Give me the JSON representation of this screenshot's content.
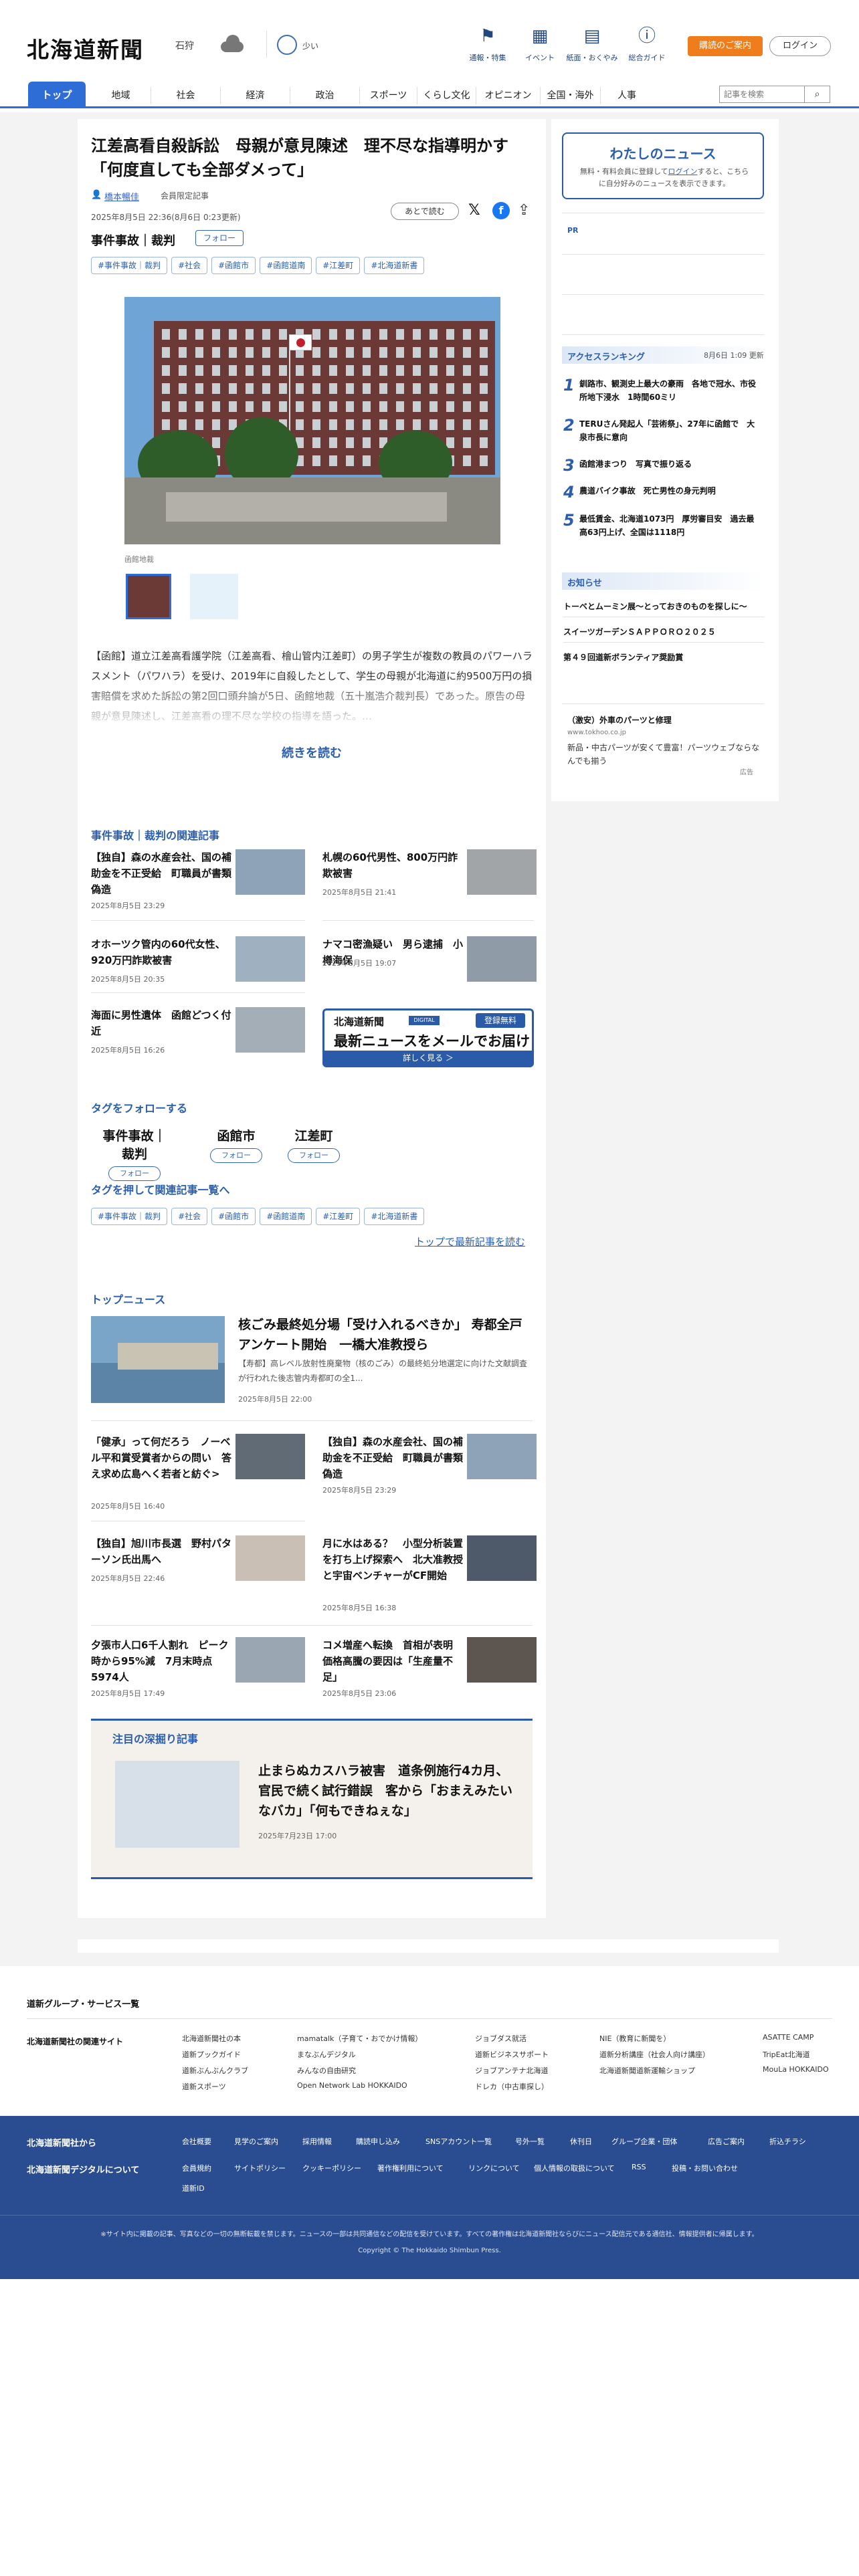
{
  "header": {
    "logo": "北海道新聞",
    "city": "石狩",
    "pollen_label": "少い",
    "top_nav": [
      {
        "label": "通報・特集",
        "icon": "flag-icon"
      },
      {
        "label": "イベント",
        "icon": "calendar-icon"
      },
      {
        "label": "紙面・おくやみ",
        "icon": "newspaper-icon"
      },
      {
        "label": "総合ガイド",
        "icon": "help-icon"
      }
    ],
    "subscribe_label": "購読のご案内",
    "login_label": "ログイン",
    "search_placeholder": "記事を検索"
  },
  "nav": [
    "トップ",
    "地域",
    "社会",
    "経済",
    "政治",
    "スポーツ",
    "くらし文化",
    "オピニオン",
    "全国・海外",
    "人事"
  ],
  "article": {
    "title": "江差高看自殺訴訟　母親が意見陳述　理不尽な指導明かす「何度直しても全部ダメって」",
    "author": "橋本暢佳",
    "member_label": "会員限定記事",
    "date": "2025年8月5日 22:36(8月6日 0:23更新)",
    "later_label": "あとで読む",
    "category": "事件事故｜裁判",
    "follow_label": "フォロー",
    "tags": [
      "#事件事故｜裁判",
      "#社会",
      "#函館市",
      "#函館道南",
      "#江差町",
      "#北海道新書"
    ],
    "photo_caption": "函館地裁",
    "lead": "【函館】道立江差高看護学院（江差高看、檜山管内江差町）の男子学生が複数の教員のパワーハラスメント（パワハラ）を受け、2019年に自殺したとして、学生の母親が北海道に約9500万円の損害賠償を求めた訴訟の第2回口頭弁論が5日、函館地裁（五十嵐浩介裁判長）であった。原告の母親が意見陳述し、江差高看の理不尽な学校の指導を語った。…",
    "read_more": "続きを読む"
  },
  "related": {
    "heading": "事件事故｜裁判の関連記事",
    "items": [
      {
        "title": "【独自】森の水産会社、国の補助金を不正受給　町職員が書類偽造",
        "date": "2025年8月5日 23:29"
      },
      {
        "title": "札幌の60代男性、800万円詐欺被害",
        "date": "2025年8月5日 21:41"
      },
      {
        "title": "オホーツク管内の60代女性、920万円詐欺被害",
        "date": "2025年8月5日 20:35"
      },
      {
        "title": "ナマコ密漁疑い　男ら逮捕　小樽海保",
        "date": "2025年8月5日 19:07"
      },
      {
        "title": "海面に男性遺体　函館どつく付近",
        "date": "2025年8月5日 16:26"
      }
    ],
    "mail_banner": {
      "logo": "北海道新聞",
      "badge": "DIGITAL",
      "free": "登録無料",
      "headline": "最新ニュースをメールでお届け",
      "cta": "詳しく見る ＞"
    }
  },
  "follow_tags": {
    "heading": "タグをフォローする",
    "items": [
      {
        "name": "事件事故｜裁判",
        "btn": "フォロー"
      },
      {
        "name": "函館市",
        "btn": "フォロー"
      },
      {
        "name": "江差町",
        "btn": "フォロー"
      }
    ]
  },
  "tag_search": {
    "heading": "タグを押して関連記事一覧へ",
    "tags": [
      "#事件事故｜裁判",
      "#社会",
      "#函館市",
      "#函館道南",
      "#江差町",
      "#北海道新書"
    ],
    "top_link": "トップで最新記事を読む"
  },
  "top_news": {
    "heading": "トップニュース",
    "lead": {
      "title": "核ごみ最終処分場「受け入れるべきか」 寿都全戸アンケート開始　一橋大准教授ら",
      "desc": "【寿都】高レベル放射性廃棄物（核のごみ）の最終処分地選定に向けた文献調査が行われた後志管内寿都町の全1...",
      "date": "2025年8月5日 22:00"
    },
    "items": [
      {
        "title": "「健承」って何だろう　ノーベル平和賞受賞者からの問い　答え求め広島へく若者と紡ぐ>",
        "date": "2025年8月5日 16:40"
      },
      {
        "title": "【独自】森の水産会社、国の補助金を不正受給　町職員が書類偽造",
        "date": "2025年8月5日 23:29"
      },
      {
        "title": "【独自】旭川市長選　野村パターソン氏出馬へ",
        "date": "2025年8月5日 22:46"
      },
      {
        "title": "月に水はある？　小型分析装置を打ち上げ探索へ　北大准教授と宇宙ベンチャーがCF開始",
        "date": "2025年8月5日 16:38"
      },
      {
        "title": "夕張市人口6千人割れ　ピーク時から95%減　7月末時点5974人",
        "date": "2025年8月5日 17:49"
      },
      {
        "title": "コメ増産へ転換　首相が表明　価格高騰の要因は「生産量不足」",
        "date": "2025年8月5日 23:06"
      }
    ]
  },
  "deep": {
    "heading": "注目の深掘り記事",
    "title": "止まらぬカスハラ被害　道条例施行4カ月、官民で続く試行錯誤　客から「おまえみたいなバカ」「何もできねぇな」",
    "date": "2025年7月23日 17:00"
  },
  "sidebar": {
    "mine_title": "わたしのニュース",
    "mine_desc_1": "無料・有料会員に登録して",
    "mine_login": "ログイン",
    "mine_desc_2": "すると、こちらに自分好みのニュースを表示できます。",
    "pr": "PR",
    "ranking_heading": "アクセスランキング",
    "ranking_updated": "8月6日 1:09 更新",
    "ranking": [
      {
        "n": "1",
        "title": "釧路市、観測史上最大の豪雨　各地で冠水、市役所地下浸水　1時間60ミリ"
      },
      {
        "n": "2",
        "title": "TERUさん発起人「芸術祭」、27年に函館で　大泉市長に意向"
      },
      {
        "n": "3",
        "title": "函館港まつり　写真で振り返る"
      },
      {
        "n": "4",
        "title": "農道バイク事故　死亡男性の身元判明"
      },
      {
        "n": "5",
        "title": "最低賃金、北海道1073円　厚労審目安　過去最高63円上げ、全国は1118円"
      }
    ],
    "notices_heading": "お知らせ",
    "notices": [
      "トーベとムーミン展～とっておきのものを探しに～",
      "スイーツガーデンＳＡＰＰＯＲＯ２０２５",
      "第４９回道新ボランティア奨励賞"
    ],
    "ad": {
      "title": "（激安）外車のパーツと修理",
      "url": "www.tokhoo.co.jp",
      "desc": "新品・中古パーツが安くて豊富！パーツウェブならなんでも揃う",
      "label": "広告"
    }
  },
  "group": {
    "heading": "道新グループ・サービス一覧",
    "title": "北海道新聞社の関連サイト",
    "cols": [
      [
        "北海道新聞社の本",
        "道新プックガイド",
        "道新ぶんぶんクラブ",
        "道新スポーツ"
      ],
      [
        "mamatalk（子育て・おでかけ情報）",
        "まなぶんデジタル",
        "みんなの自由研究",
        "Open Network Lab HOKKAIDO"
      ],
      [
        "ジョブダス就活",
        "道新ビジネスサポート",
        "ジョブアンテナ北海道",
        "ドレカ（中古車探し）"
      ],
      [
        "NIE（教育に新聞を）",
        "道新分析講座（社会人向け講座）",
        "北海道新聞道新運輸ショップ"
      ],
      [
        "ASATTE CAMP",
        "TripEat北海道",
        "MouLa HOKKAIDO"
      ]
    ]
  },
  "footer": {
    "h1": "北海道新聞社から",
    "h2": "北海道新聞デジタルについて",
    "row1": [
      "会社概要",
      "見学のご案内",
      "採用情報",
      "購読申し込み",
      "SNSアカウント一覧",
      "号外一覧",
      "休刊日",
      "グループ企業・団体",
      "広告ご案内",
      "折込チラシ"
    ],
    "row2": [
      "会員規約",
      "サイトポリシー",
      "クッキーポリシー",
      "著作権利用について",
      "リンクについて",
      "個人情報の取扱について",
      "RSS",
      "投稿・お問い合わせ"
    ],
    "row3": "道新ID",
    "note": "※サイト内に掲載の記事、写真などの一切の無断転載を禁じます。ニュースの一部は共同通信などの配信を受けています。すべての著作権は北海道新聞社ならびにニュース配信元である通信社、情報提供者に帰属します。",
    "copyright": "Copyright © The Hokkaido Shimbun Press."
  }
}
